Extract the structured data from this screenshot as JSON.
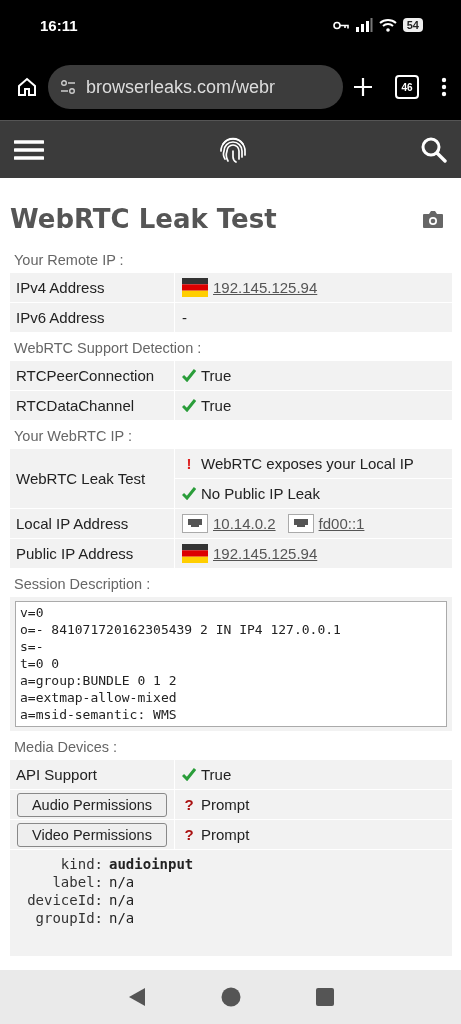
{
  "status_bar": {
    "time": "16:11",
    "battery": "54"
  },
  "browser": {
    "url": "browserleaks.com/webr",
    "tab_count": "46"
  },
  "page": {
    "title": "WebRTC Leak Test"
  },
  "sections": [
    {
      "heading": "Your Remote IP :",
      "rows": [
        {
          "kind": "pair",
          "label": "IPv4 Address",
          "values": [
            {
              "kind": "flag",
              "text": "192.145.125.94",
              "link": true
            }
          ]
        },
        {
          "kind": "pair",
          "label": "IPv6 Address",
          "values": [
            {
              "kind": "plain",
              "text": "-",
              "link": false
            }
          ]
        }
      ]
    },
    {
      "heading": "WebRTC Support Detection :",
      "rows": [
        {
          "kind": "pair",
          "label": "RTCPeerConnection",
          "values": [
            {
              "kind": "check",
              "text": "True",
              "link": false
            }
          ]
        },
        {
          "kind": "pair",
          "label": "RTCDataChannel",
          "values": [
            {
              "kind": "check",
              "text": "True",
              "link": false
            }
          ]
        }
      ]
    },
    {
      "heading": "Your WebRTC IP :",
      "rows": [
        {
          "kind": "stacked",
          "label": "WebRTC Leak Test",
          "values": [
            {
              "kind": "alert",
              "mark": "!",
              "text": "WebRTC exposes your Local IP",
              "link": false
            },
            {
              "kind": "check",
              "text": "No Public IP Leak",
              "link": false
            }
          ]
        },
        {
          "kind": "pair",
          "label": "Local IP Address",
          "values": [
            {
              "kind": "network",
              "text": "10.14.0.2",
              "link": true
            },
            {
              "kind": "network",
              "text": "fd00::1",
              "link": true
            }
          ]
        },
        {
          "kind": "pair",
          "label": "Public IP Address",
          "values": [
            {
              "kind": "flag",
              "text": "192.145.125.94",
              "link": true
            }
          ]
        }
      ]
    },
    {
      "heading": "Session Description :",
      "rows": [
        {
          "kind": "text",
          "lines": [
            "v=0",
            "o=- 841071720162305439 2 IN IP4 127.0.0.1",
            "s=-",
            "t=0 0",
            "a=group:BUNDLE 0 1 2",
            "a=extmap-allow-mixed",
            "a=msid-semantic: WMS"
          ]
        }
      ]
    },
    {
      "heading": "Media Devices :",
      "rows": [
        {
          "kind": "pair",
          "label": "API Support",
          "values": [
            {
              "kind": "check",
              "text": "True",
              "link": false
            }
          ]
        },
        {
          "kind": "button",
          "label": "Audio Permissions",
          "values": [
            {
              "kind": "question",
              "mark": "?",
              "text": "Prompt",
              "link": false
            }
          ]
        },
        {
          "kind": "button",
          "label": "Video Permissions",
          "values": [
            {
              "kind": "question",
              "mark": "?",
              "text": "Prompt",
              "link": false
            }
          ]
        },
        {
          "kind": "device",
          "fields": [
            {
              "key": "kind:",
              "value": "audioinput",
              "strong": true
            },
            {
              "key": "label:",
              "value": "n/a",
              "strong": false
            },
            {
              "key": "deviceId:",
              "value": "n/a",
              "strong": false
            },
            {
              "key": "groupId:",
              "value": "n/a",
              "strong": false
            }
          ]
        }
      ]
    }
  ]
}
